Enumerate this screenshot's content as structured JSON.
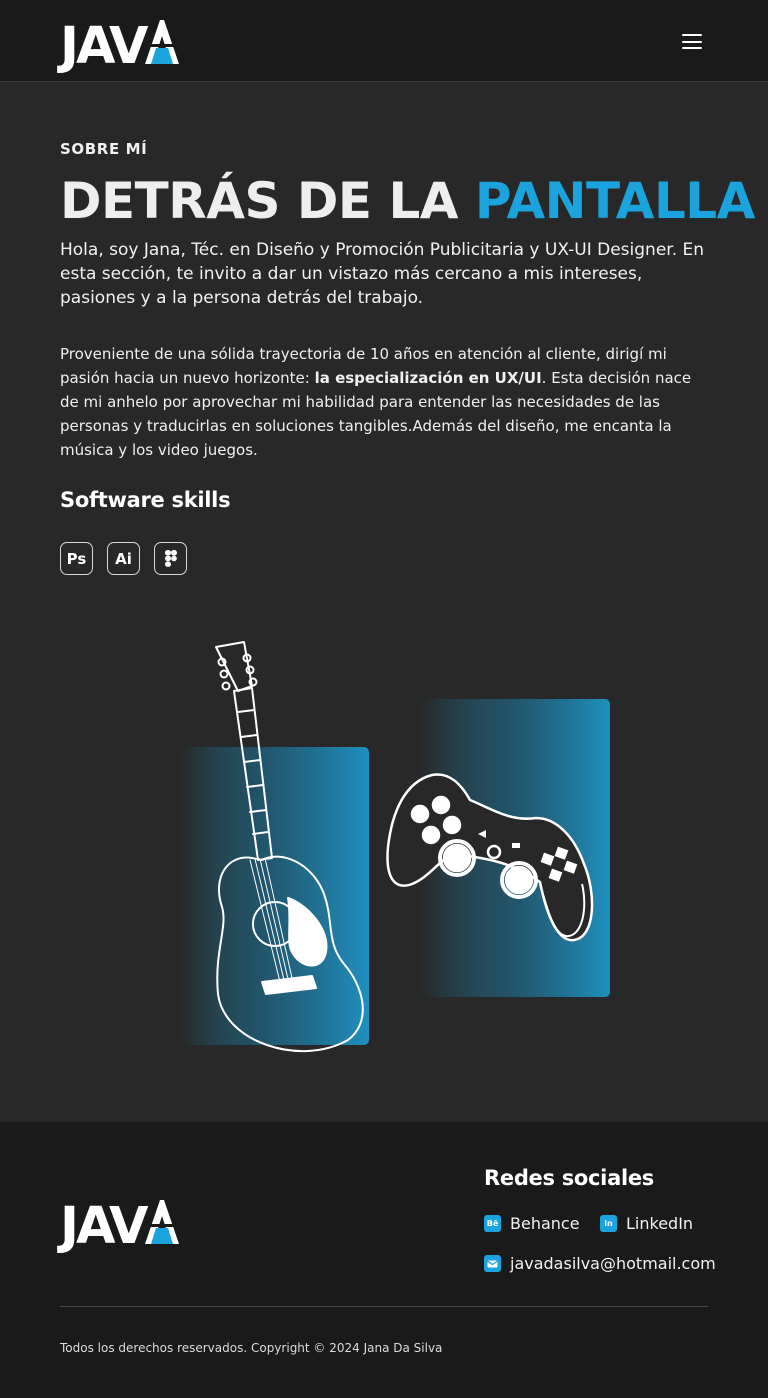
{
  "header": {
    "logo_text": "JAV",
    "menu_icon": "hamburger-menu-icon"
  },
  "about": {
    "eyebrow": "SOBRE MÍ",
    "headline_part1": "DETRÁS DE LA ",
    "headline_accent": "PANTALLA",
    "intro": "Hola, soy Jana, Téc. en Diseño y Promoción Publicitaria y UX-UI Designer. En esta sección, te invito a dar un vistazo más cercano a mis intereses, pasiones y a la persona detrás del trabajo.",
    "body_before": "Proveniente de una sólida trayectoria de 10 años en atención al cliente, dirigí mi pasión hacia un nuevo horizonte: ",
    "body_bold": "la especialización en UX/UI",
    "body_after": ". Esta decisión nace de mi anhelo por aprovechar mi habilidad para entender las necesidades de las personas y traducirlas en soluciones tangibles.Además del diseño, me encanta la música y los video juegos.",
    "skills_title": "Software skills",
    "skills": [
      {
        "label": "Ps",
        "icon": "photoshop-icon"
      },
      {
        "label": "Ai",
        "icon": "illustrator-icon"
      },
      {
        "label": "",
        "icon": "figma-icon"
      }
    ]
  },
  "footer": {
    "logo_text": "JAV",
    "social_title": "Redes sociales",
    "behance_label": "Behance",
    "behance_icon_text": "Bē",
    "linkedin_label": "LinkedIn",
    "linkedin_icon_text": "in",
    "email_label": "javadasilva@hotmail.com",
    "copyright": "Todos los derechos reservados. Copyright © 2024 Jana Da Silva"
  },
  "colors": {
    "accent": "#1aa3dc",
    "background": "#282828",
    "header_bg": "#1a1a1a"
  }
}
